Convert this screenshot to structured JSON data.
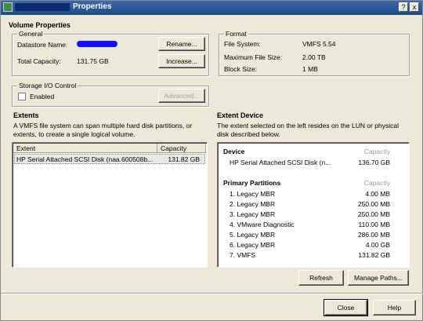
{
  "window": {
    "title": "Properties",
    "controls": [
      "?",
      "x"
    ]
  },
  "volume": {
    "heading": "Volume Properties",
    "general": {
      "label": "General",
      "datastore_name_label": "Datastore Name:",
      "total_capacity_label": "Total Capacity:",
      "total_capacity_value": "131.75 GB",
      "rename_button": "Rename...",
      "increase_button": "Increase..."
    },
    "format": {
      "label": "Format",
      "rows": [
        {
          "key": "File System:",
          "value": "VMFS 5.54"
        },
        {
          "key": "Maximum File Size:",
          "value": "2.00 TB"
        },
        {
          "key": "Block Size:",
          "value": "1 MB"
        }
      ]
    },
    "sioc": {
      "label": "Storage I/O Control",
      "enabled_label": "Enabled",
      "enabled": false,
      "advanced_button": "Advanced..."
    }
  },
  "extents": {
    "heading": "Extents",
    "description": "A VMFS file system can span multiple hard disk partitions, or extents, to create a single logical volume.",
    "columns": [
      "Extent",
      "Capacity"
    ],
    "rows": [
      {
        "extent": "HP Serial Attached SCSI Disk (naa.600508b...",
        "capacity": "131.82 GB"
      }
    ]
  },
  "extent_device": {
    "heading": "Extent Device",
    "description": "The extent selected on the left resides on the LUN or physical disk described below.",
    "device_heading": "Device",
    "capacity_heading": "Capacity",
    "device_name": "HP Serial Attached SCSI Disk (n...",
    "device_capacity": "136.70 GB",
    "partitions_heading": "Primary Partitions",
    "partitions": [
      {
        "name": "1. Legacy MBR",
        "capacity": "4.00 MB"
      },
      {
        "name": "2. Legacy MBR",
        "capacity": "250.00 MB"
      },
      {
        "name": "3. Legacy MBR",
        "capacity": "250.00 MB"
      },
      {
        "name": "4. VMware Diagnostic",
        "capacity": "110.00 MB"
      },
      {
        "name": "5. Legacy MBR",
        "capacity": "286.00 MB"
      },
      {
        "name": "6. Legacy MBR",
        "capacity": "4.00 GB"
      },
      {
        "name": "7. VMFS",
        "capacity": "131.82 GB"
      }
    ],
    "refresh_button": "Refresh",
    "manage_paths_button": "Manage Paths..."
  },
  "footer": {
    "close_button": "Close",
    "help_button": "Help"
  }
}
